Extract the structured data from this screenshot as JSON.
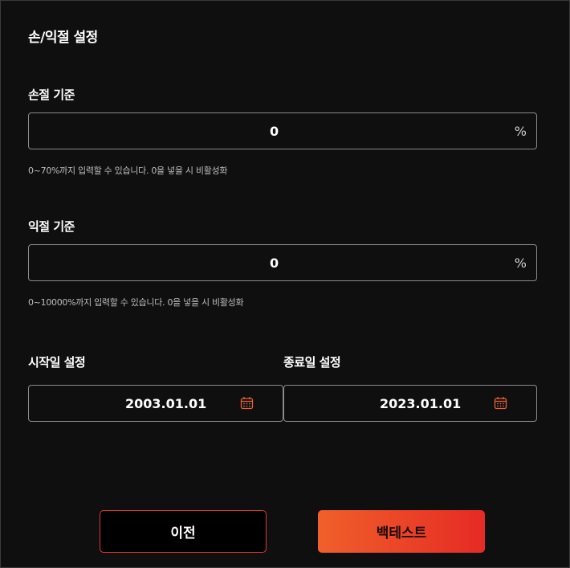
{
  "title": "손/익절 설정",
  "stop_loss": {
    "label": "손절 기준",
    "value": "0",
    "unit": "%",
    "hint": "0~70%까지 입력할 수 있습니다. 0을 넣을 시 비활성화"
  },
  "take_profit": {
    "label": "익절 기준",
    "value": "0",
    "unit": "%",
    "hint": "0~10000%까지 입력할 수 있습니다. 0을 넣을 시 비활성화"
  },
  "start_date": {
    "label": "시작일 설정",
    "value": "2003.01.01",
    "icon": "calendar-icon"
  },
  "end_date": {
    "label": "종료일 설정",
    "value": "2023.01.01",
    "icon": "calendar-icon"
  },
  "buttons": {
    "prev_label": "이전",
    "backtest_label": "백테스트"
  },
  "colors": {
    "accent": "#e0392b",
    "accent_gradient_start": "#f0602a",
    "accent_gradient_end": "#e62a25",
    "icon": "#e8613a"
  }
}
